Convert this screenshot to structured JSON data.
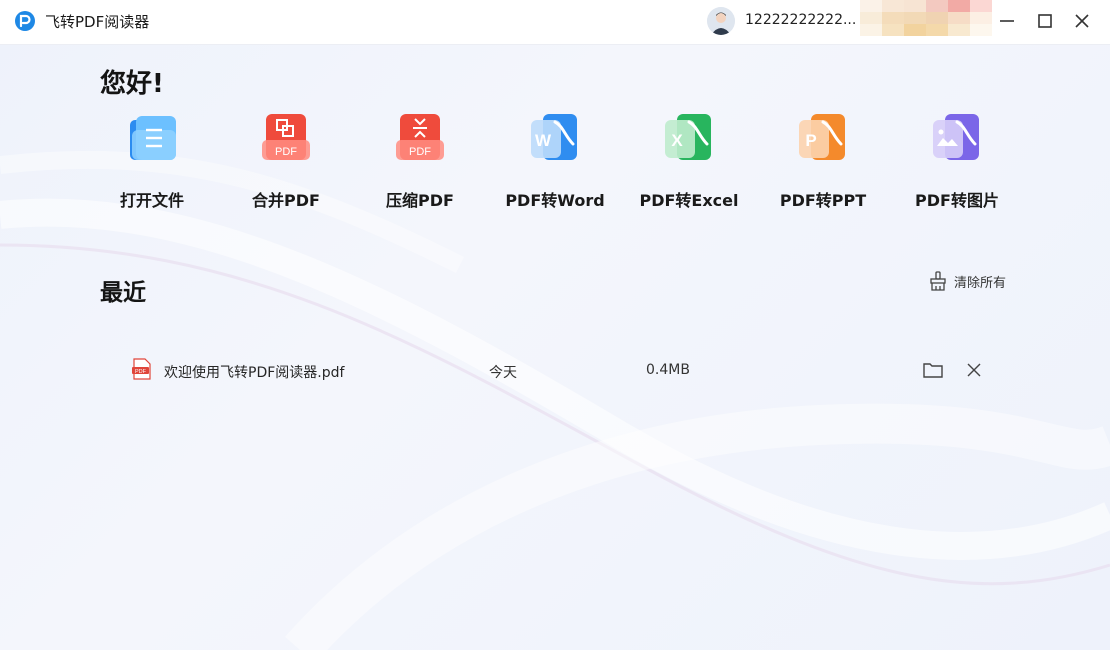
{
  "app": {
    "title": "飞转PDF阅读器"
  },
  "user": {
    "name": "12222222222..."
  },
  "home": {
    "greeting": "您好!",
    "tools": [
      {
        "label": "打开文件",
        "icon": "folder-open-icon"
      },
      {
        "label": "合并PDF",
        "icon": "merge-pdf-icon"
      },
      {
        "label": "压缩PDF",
        "icon": "compress-pdf-icon"
      },
      {
        "label": "PDF转Word",
        "icon": "word-convert-icon"
      },
      {
        "label": "PDF转Excel",
        "icon": "excel-convert-icon"
      },
      {
        "label": "PDF转PPT",
        "icon": "ppt-convert-icon"
      },
      {
        "label": "PDF转图片",
        "icon": "image-convert-icon"
      }
    ]
  },
  "recent": {
    "title": "最近",
    "clear_label": "清除所有",
    "files": [
      {
        "name": "欢迎使用飞转PDF阅读器.pdf",
        "date": "今天",
        "size": "0.4MB"
      }
    ]
  },
  "colors": {
    "brand": "#1e88e5",
    "pdf_red": "#ef4b3c",
    "word_blue": "#2f8df0",
    "excel_green": "#28b55e",
    "ppt_orange": "#f48a2c",
    "image_purple": "#7b66e8"
  }
}
